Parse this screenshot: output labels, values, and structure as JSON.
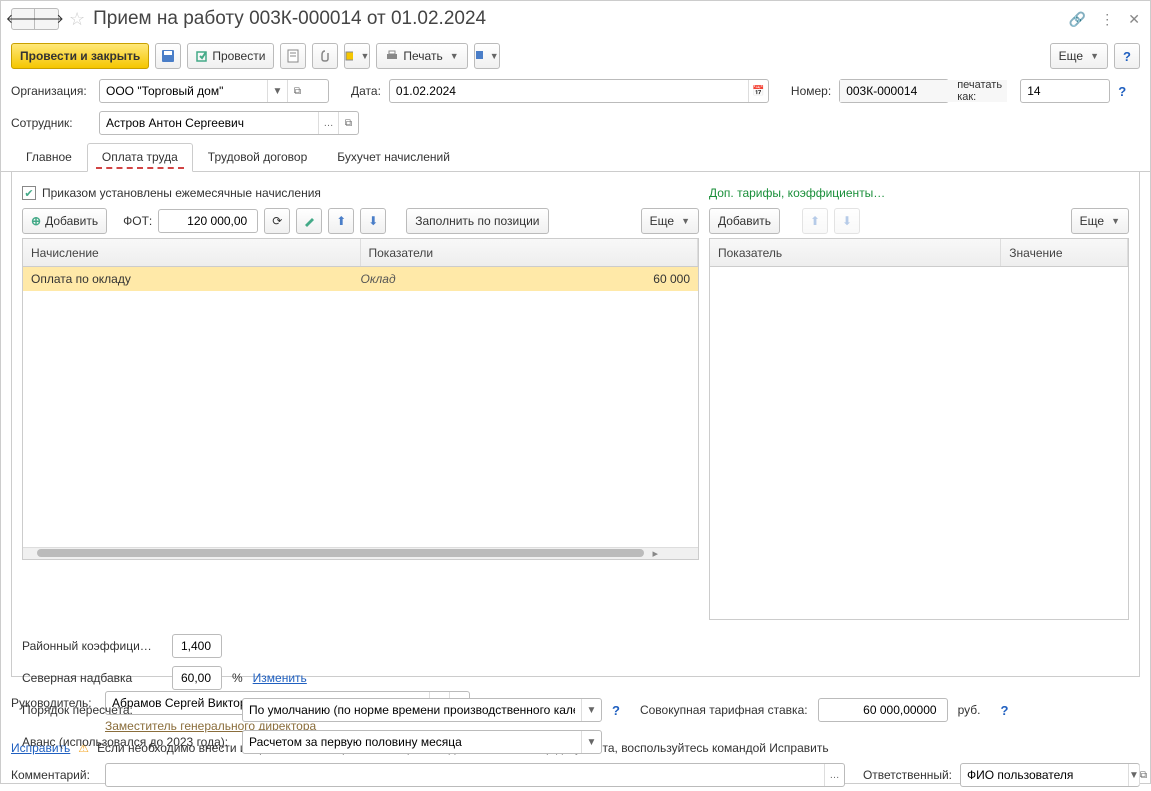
{
  "title": "Прием на работу 003К-000014 от 01.02.2024",
  "toolbar": {
    "post_close": "Провести и закрыть",
    "post": "Провести",
    "print": "Печать",
    "more": "Еще"
  },
  "form": {
    "org_label": "Организация:",
    "org_value": "ООО \"Торговый дом\"",
    "date_label": "Дата:",
    "date_value": "01.02.2024",
    "number_label": "Номер:",
    "number_value": "003К-000014",
    "print_as_label": "печатать как:",
    "print_as_value": "14",
    "employee_label": "Сотрудник:",
    "employee_value": "Астров Антон Сергеевич"
  },
  "tabs": {
    "main": "Главное",
    "payment": "Оплата труда",
    "contract": "Трудовой договор",
    "accounting": "Бухучет начислений"
  },
  "payment": {
    "checkbox_label": "Приказом установлены ежемесячные начисления",
    "extra_link": "Доп. тарифы, коэффициенты…",
    "add_btn": "Добавить",
    "fot_label": "ФОТ:",
    "fot_value": "120 000,00",
    "fill_position": "Заполнить по позиции",
    "more": "Еще",
    "add2": "Добавить",
    "table1": {
      "col1": "Начисление",
      "col2": "Показатели",
      "row1_name": "Оплата по окладу",
      "row1_indicator": "Оклад",
      "row1_value": "60 000"
    },
    "table2": {
      "col1": "Показатель",
      "col2": "Значение"
    },
    "district_label": "Районный коэффици…",
    "district_value": "1,400",
    "north_label": "Северная надбавка",
    "north_value": "60,00",
    "percent": "%",
    "change_link": "Изменить",
    "recalc_label": "Порядок пересчета:",
    "recalc_value": "По умолчанию (по норме времени производственного кален",
    "rate_label": "Совокупная тарифная ставка:",
    "rate_value": "60 000,00000",
    "rub": "руб.",
    "advance_label": "Аванс (использовался до 2023 года):",
    "advance_value": "Расчетом за первую половину месяца"
  },
  "footer": {
    "manager_label": "Руководитель:",
    "manager_value": "Абрамов Сергей Викторович",
    "manager_position": "Заместитель генерального директора",
    "fix_link": "Исправить",
    "warning_text": "Если необходимо внести исправление, но при этом сохранить данный экземпляр документа, воспользуйтесь командой Исправить",
    "comment_label": "Комментарий:",
    "responsible_label": "Ответственный:",
    "responsible_value": "ФИО пользователя"
  },
  "help": "?"
}
